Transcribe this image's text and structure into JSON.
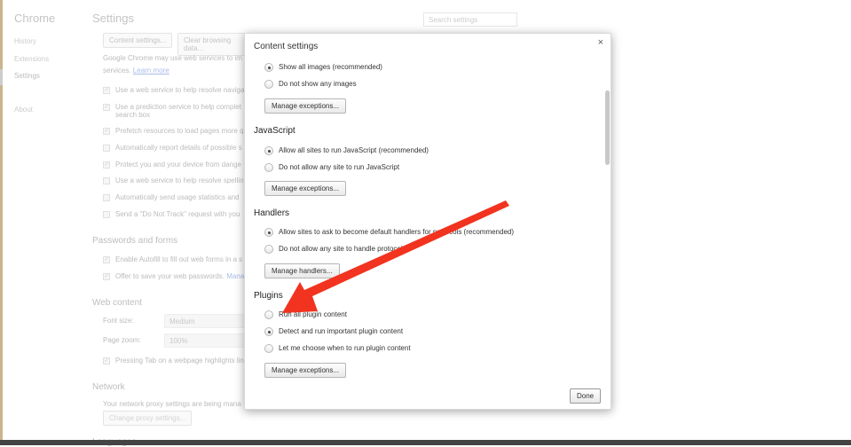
{
  "sidebar": {
    "title": "Chrome",
    "items": [
      "History",
      "Extensions",
      "Settings",
      "About"
    ],
    "selected": "Settings"
  },
  "settings": {
    "title": "Settings",
    "search_placeholder": "Search settings",
    "buttons": [
      "Content settings...",
      "Clear browsing data..."
    ],
    "privacy_text": "Google Chrome may use web services to im",
    "privacy_text2": "services.",
    "learn_more": "Learn more",
    "privacy_options": [
      {
        "label": "Use a web service to help resolve naviga",
        "checked": true
      },
      {
        "label": "Use a prediction service to help complet",
        "label2": "search box",
        "checked": true
      },
      {
        "label": "Prefetch resources to load pages more q",
        "checked": true
      },
      {
        "label": "Automatically report details of possible s",
        "checked": false
      },
      {
        "label": "Protect you and your device from dange",
        "checked": true
      },
      {
        "label": "Use a web service to help resolve spellin",
        "checked": false
      },
      {
        "label": "Automatically send usage statistics and",
        "checked": false
      },
      {
        "label": "Send a \"Do Not Track\" request with you",
        "checked": false
      }
    ],
    "passwords": {
      "title": "Passwords and forms",
      "options": [
        {
          "label": "Enable Autofill to fill out web forms in a s",
          "checked": true
        },
        {
          "label": "Offer to save your web passwords.",
          "link": "Mana",
          "checked": true
        }
      ]
    },
    "web_content": {
      "title": "Web content",
      "font_size_label": "Font size:",
      "font_size": "Medium",
      "page_zoom_label": "Page zoom:",
      "page_zoom": "100%",
      "tab_option": "Pressing Tab on a webpage highlights lin"
    },
    "network": {
      "title": "Network",
      "text": "Your network proxy settings are being mana",
      "button": "Change proxy settings..."
    },
    "languages": {
      "title": "Languages"
    }
  },
  "dialog": {
    "title": "Content settings",
    "close": "×",
    "done": "Done",
    "sections": [
      {
        "title": "",
        "options": [
          {
            "label": "Show all images (recommended)",
            "selected": true
          },
          {
            "label": "Do not show any images",
            "selected": false
          }
        ],
        "button": "Manage exceptions..."
      },
      {
        "title": "JavaScript",
        "options": [
          {
            "label": "Allow all sites to run JavaScript (recommended)",
            "selected": true
          },
          {
            "label": "Do not allow any site to run JavaScript",
            "selected": false
          }
        ],
        "button": "Manage exceptions..."
      },
      {
        "title": "Handlers",
        "options": [
          {
            "label": "Allow sites to ask to become default handlers for protocols (recommended)",
            "selected": true
          },
          {
            "label": "Do not allow any site to handle protocols",
            "selected": false
          }
        ],
        "button": "Manage handlers..."
      },
      {
        "title": "Plugins",
        "options": [
          {
            "label": "Run all plugin content",
            "selected": false
          },
          {
            "label": "Detect and run important plugin content",
            "selected": true
          },
          {
            "label": "Let me choose when to run plugin content",
            "selected": false
          }
        ],
        "button": "Manage exceptions..."
      }
    ]
  },
  "annotation": {
    "arrow_color": "#f2331f"
  }
}
